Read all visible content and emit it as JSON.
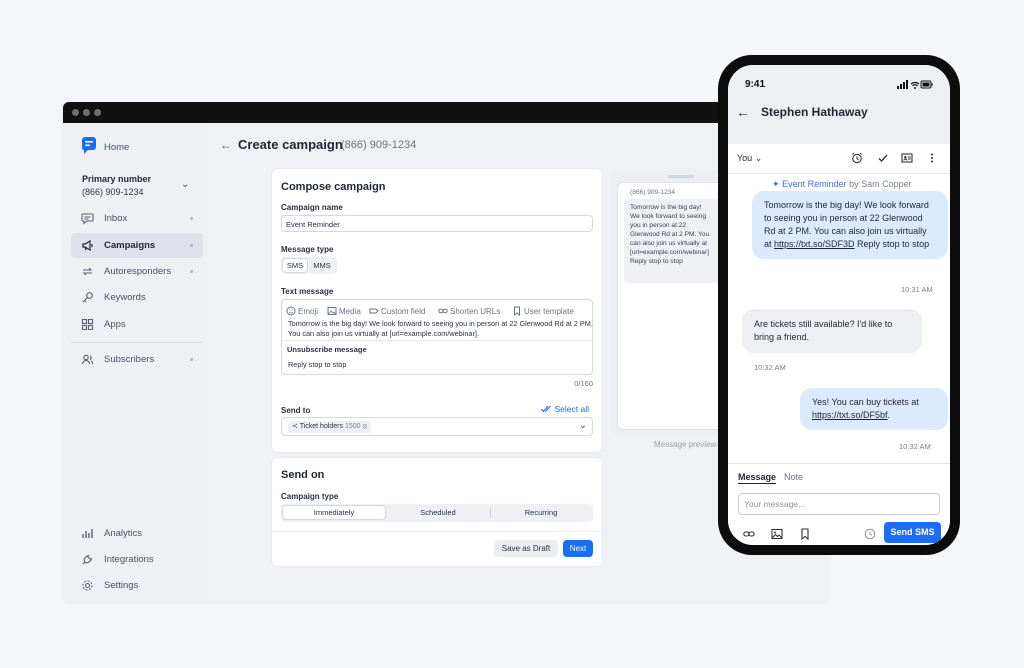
{
  "sidebar": {
    "home": "Home",
    "primary_title": "Primary number",
    "primary_number": "(866) 909-1234",
    "items": [
      {
        "label": "Inbox"
      },
      {
        "label": "Campaigns"
      },
      {
        "label": "Autoresponders"
      },
      {
        "label": "Keywords"
      },
      {
        "label": "Apps"
      },
      {
        "label": "Subscribers"
      },
      {
        "label": "Analytics"
      },
      {
        "label": "Integrations"
      },
      {
        "label": "Settings"
      }
    ]
  },
  "header": {
    "title": "Create campaign",
    "phone": "(866) 909-1234"
  },
  "compose": {
    "title": "Compose campaign",
    "name_label": "Campaign name",
    "name_value": "Event Reminder",
    "type_label": "Message type",
    "types": [
      "SMS",
      "MMS"
    ],
    "text_label": "Text message",
    "toolbar": [
      "Emoji",
      "Media",
      "Custom field",
      "Shorten URLs",
      "User template"
    ],
    "message": "Tomorrow is the big day! We look forward to seeing you in person at 22 Glenwood Rd at 2 PM. You can also join us virtually at [url=example.com/webinar].",
    "unsub_label": "Unsubscribe message",
    "unsub_value": "Reply stop to stop",
    "counter": "0/160",
    "send_to_label": "Send to",
    "select_all": "Select all",
    "chip_label": "Ticket holders",
    "chip_count": "1500"
  },
  "send_on": {
    "title": "Send on",
    "type_label": "Campaign type",
    "options": [
      "Immediately",
      "Scheduled",
      "Recurring"
    ],
    "draft_button": "Save as Draft",
    "next_button": "Next"
  },
  "preview": {
    "number": "(866) 909-1234",
    "lines": [
      "Tomorrow is the big day!",
      "We look forward to seeing",
      "you in person at 22",
      "Glenwood Rd at 2 PM. You",
      "can also join us virtually at",
      "[url=example.com/webinar]",
      "Reply stop to stop"
    ],
    "caption": "Message preview"
  },
  "phone": {
    "time": "9:41",
    "contact": "Stephen Hathaway",
    "you_label": "You",
    "tag_campaign": "Event Reminder",
    "tag_by": "by Sam Copper",
    "messages": [
      {
        "text_before": "Tomorrow is the big day! We look forward to seeing you in person at 22 Glenwood Rd at 2 PM. You can also join us virtually at ",
        "link": "https://txt.so/SDF3D",
        "text_after": " Reply stop to stop",
        "time": "10:31 AM"
      },
      {
        "text": "Are tickets still available? I'd like to bring a friend.",
        "time": "10:32 AM"
      },
      {
        "text_before": "Yes! You can buy tickets at ",
        "link": "https://txt.so/DF5bf",
        "text_after": ".",
        "time": "10:32 AM"
      }
    ],
    "tab_message": "Message",
    "tab_note": "Note",
    "input_placeholder": "Your message...",
    "send_button": "Send SMS"
  },
  "colors": {
    "accent": "#1b6ef3",
    "outgoing_bubble": "#dbeafd",
    "incoming_bubble": "#edeff2"
  }
}
